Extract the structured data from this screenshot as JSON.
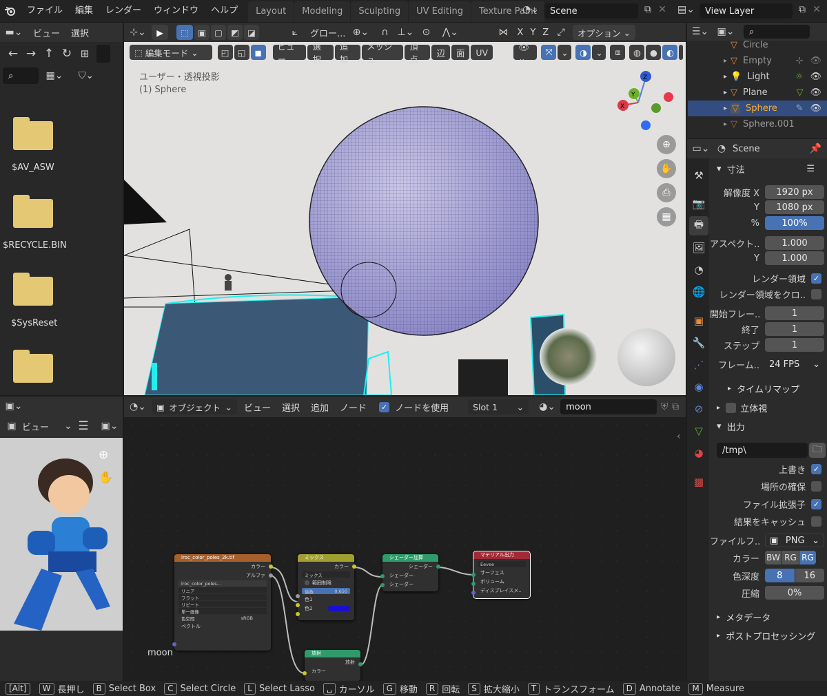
{
  "topbar": {
    "menus": [
      "ファイル",
      "編集",
      "レンダー",
      "ウィンドウ",
      "ヘルプ"
    ],
    "workspaces": [
      "Layout",
      "Modeling",
      "Sculpting",
      "UV Editing",
      "Texture Paint"
    ],
    "scene": "Scene",
    "view_layer": "View Layer"
  },
  "file_browser": {
    "header": [
      "ビュー",
      "選択"
    ],
    "folders": [
      "$AV_ASW",
      "$RECYCLE.BIN",
      "$SysReset"
    ]
  },
  "viewport": {
    "header_tool": "グロー...",
    "options": "オプション",
    "mode": "編集モード",
    "menus": [
      "ビュー",
      "選択",
      "追加",
      "メッシュ",
      "頂点",
      "辺",
      "面",
      "UV"
    ],
    "overlay_title": "ユーザー・透視投影",
    "overlay_obj": "(1) Sphere",
    "gizmo": {
      "x": "X",
      "y": "Y",
      "z": "Z"
    }
  },
  "outliner": {
    "items": [
      "Circle",
      "Empty",
      "Light",
      "Plane",
      "Sphere",
      "Sphere.001"
    ],
    "selected": "Sphere"
  },
  "properties": {
    "scene": "Scene",
    "dimensions_title": "寸法",
    "res_x_label": "解像度 X",
    "res_x": "1920 px",
    "res_y_label": "Y",
    "res_y": "1080 px",
    "res_pct_label": "%",
    "res_pct": "100%",
    "aspect_label": "アスペクト..",
    "aspect_x": "1.000",
    "aspect_y_label": "Y",
    "aspect_y": "1.000",
    "render_region": "レンダー領域",
    "crop_region": "レンダー領域をクロ..",
    "frame_start_label": "開始フレー..",
    "frame_start": "1",
    "frame_end_label": "終了",
    "frame_end": "1",
    "frame_step_label": "ステップ",
    "frame_step": "1",
    "fps_label": "フレーム..",
    "fps": "24 FPS",
    "time_remap": "タイムリマップ",
    "stereo": "立体視",
    "output_title": "出力",
    "output_path": "/tmp\\",
    "overwrite": "上書き",
    "placeholders": "場所の確保",
    "file_ext": "ファイル拡張子",
    "cache_result": "結果をキャッシュ",
    "file_format_label": "ファイルフ..",
    "file_format": "PNG",
    "color_label": "カラー",
    "color_bw": "BW",
    "color_rgb": "RG",
    "color_rgba": "RG",
    "depth_label": "色深度",
    "depth_8": "8",
    "depth_16": "16",
    "compression_label": "圧縮",
    "compression": "0%",
    "metadata": "メタデータ",
    "postprocess": "ポストプロセッシング"
  },
  "image_editor": {
    "view": "ビュー"
  },
  "node_editor": {
    "object": "オブジェクト",
    "menus": [
      "ビュー",
      "選択",
      "追加",
      "ノード"
    ],
    "use_nodes": "ノードを使用",
    "slot": "Slot 1",
    "material": "moon",
    "material_label": "moon",
    "nodes": {
      "tex_title": "lroc_color_poles_2k.tif",
      "tex_color": "カラー",
      "tex_alpha": "アルファ",
      "tex_img": "lroc_color_poles...",
      "tex_interp": "リニア",
      "tex_proj": "フラット",
      "tex_ext": "リピート",
      "tex_src": "単一画像",
      "tex_cs_label": "色空間",
      "tex_cs": "sRGB",
      "tex_vec": "ベクトル",
      "mix_title": "ミックス",
      "mix_out": "カラー",
      "mix_mode": "ミックス",
      "mix_clamp": "範囲制限",
      "mix_fac_label": "係数",
      "mix_fac": "0.650",
      "mix_c1": "色1",
      "mix_c2": "色2",
      "add_title": "シェーダー加算",
      "add_out": "シェーダー",
      "add_in1": "シェーダー",
      "add_in2": "シェーダー",
      "out_title": "マテリアル出力",
      "out_target": "Eevee",
      "out_surface": "サーフェス",
      "out_volume": "ボリューム",
      "out_disp": "ディスプレイスメ..",
      "em_title": "放射",
      "em_out": "放射",
      "em_color": "カラー"
    }
  },
  "statusbar": [
    {
      "k": "[Alt]",
      "t": ""
    },
    {
      "k": "W",
      "t": "長押し"
    },
    {
      "k": "B",
      "t": "Select Box"
    },
    {
      "k": "C",
      "t": "Select Circle"
    },
    {
      "k": "L",
      "t": "Select Lasso"
    },
    {
      "k": "␣",
      "t": "カーソル"
    },
    {
      "k": "G",
      "t": "移動"
    },
    {
      "k": "R",
      "t": "回転"
    },
    {
      "k": "S",
      "t": "拡大縮小"
    },
    {
      "k": "T",
      "t": "トランスフォーム"
    },
    {
      "k": "D",
      "t": "Annotate"
    },
    {
      "k": "M",
      "t": "Measure"
    }
  ]
}
